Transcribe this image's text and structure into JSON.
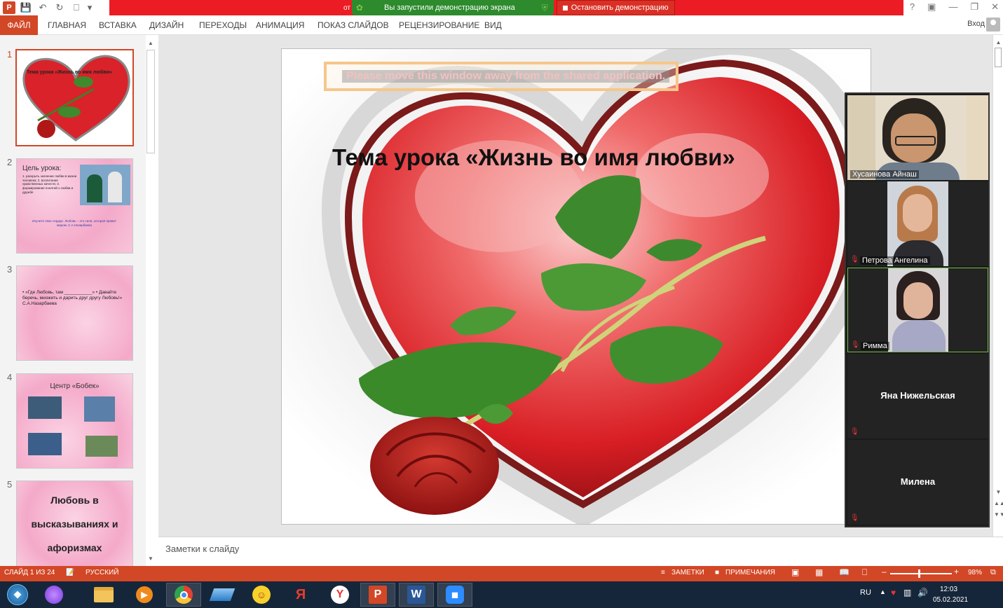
{
  "app": {
    "share_prefix": "от",
    "share_notice": "Вы запустили демонстрацию экрана",
    "stop_label": "Остановить демонстрацию",
    "login": "Вход"
  },
  "ribbon": {
    "tabs": [
      "ФАЙЛ",
      "ГЛАВНАЯ",
      "ВСТАВКА",
      "ДИЗАЙН",
      "ПЕРЕХОДЫ",
      "АНИМАЦИЯ",
      "ПОКАЗ СЛАЙДОВ",
      "РЕЦЕНЗИРОВАНИЕ",
      "ВИД"
    ]
  },
  "thumbnails": [
    {
      "num": "1",
      "text": "Тема урока «Жизнь во имя любви»"
    },
    {
      "num": "2",
      "title": "Цель урока:",
      "text": "1. раскрыть значение любви в жизни человека; 2. воспитание нравственных качеств; 3. формирование понятий о любви и дружбе",
      "quote": "Изучите свое сердце. Любовь – это сила, которая правит миром. С.А.Назарбаева"
    },
    {
      "num": "3",
      "text": "• «Где Любовь, там ___________» • Давайте беречь, множить и дарить друг другу Любовь!» С.А.Назарбаева"
    },
    {
      "num": "4",
      "text": "Центр «Бобек»"
    },
    {
      "num": "5",
      "text": "Любовь в высказываниях и афоризмах"
    }
  ],
  "slide": {
    "title": "Тема урока «Жизнь во имя любви»",
    "overlay": "Please move this window away from the shared application."
  },
  "notes_placeholder": "Заметки к слайду",
  "participants": [
    {
      "name": "Хусаинова Айнаш",
      "video": true,
      "muted": false
    },
    {
      "name": "Петрова Ангелина",
      "video": true,
      "muted": true
    },
    {
      "name": "Римма",
      "video": true,
      "muted": true
    },
    {
      "name": "Яна Нижельская",
      "video": false,
      "muted": true
    },
    {
      "name": "Милена",
      "video": false,
      "muted": true
    }
  ],
  "status": {
    "slide_info": "СЛАЙД 1 ИЗ 24",
    "language": "РУССКИЙ",
    "notes": "ЗАМЕТКИ",
    "comments": "ПРИМЕЧАНИЯ",
    "zoom": "98%",
    "zoom_fraction": 0.49
  },
  "taskbar": {
    "lang": "RU",
    "time": "12:03",
    "date": "05.02.2021"
  },
  "colors": {
    "accent": "#d24726",
    "share_red": "#ec1c24",
    "share_green": "#2d8b2d",
    "taskbar": "#16263a"
  }
}
